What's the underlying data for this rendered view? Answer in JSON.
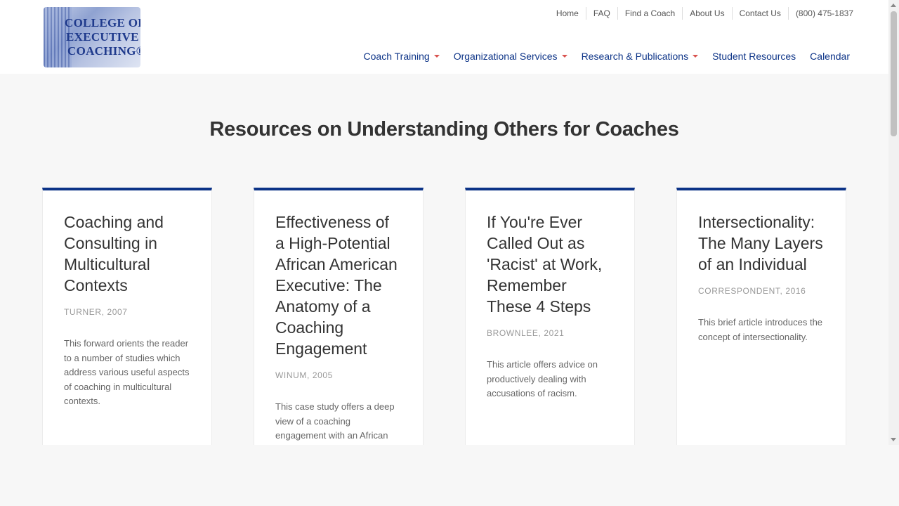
{
  "logo": {
    "line1": "COLLEGE OF",
    "line2": "EXECUTIVE",
    "line3": "COACHING®"
  },
  "top_nav": [
    {
      "label": "Home"
    },
    {
      "label": "FAQ"
    },
    {
      "label": "Find a Coach"
    },
    {
      "label": "About Us"
    },
    {
      "label": "Contact Us"
    },
    {
      "label": "(800) 475-1837"
    }
  ],
  "main_nav": [
    {
      "label": "Coach Training",
      "dropdown": true
    },
    {
      "label": "Organizational Services",
      "dropdown": true
    },
    {
      "label": "Research & Publications",
      "dropdown": true
    },
    {
      "label": "Student Resources",
      "dropdown": false
    },
    {
      "label": "Calendar",
      "dropdown": false
    }
  ],
  "page": {
    "title": "Resources on Understanding Others for Coaches"
  },
  "cards": [
    {
      "title": "Coaching and Consulting in Multicultural Contexts",
      "meta": "TURNER, 2007",
      "description": "This forward orients the reader to a number of studies which address various useful aspects of coaching in multicultural contexts."
    },
    {
      "title": "Effectiveness of a High-Potential African American Executive: The Anatomy of a Coaching Engagement",
      "meta": "WINUM, 2005",
      "description": "This case study offers a deep view of a coaching engagement with an African"
    },
    {
      "title": "If You're Ever Called Out as 'Racist' at Work, Remember These 4 Steps",
      "meta": "BROWNLEE, 2021",
      "description": "This article offers advice on productively dealing with accusations of racism."
    },
    {
      "title": "Intersectionality: The Many Layers of an Individual",
      "meta": "CORRESPONDENT, 2016",
      "description": "This brief article introduces the concept of intersectionality."
    }
  ],
  "colors": {
    "brand_blue": "#0c3387",
    "caret_red": "#d9534f",
    "page_bg": "#f7f7f7"
  }
}
